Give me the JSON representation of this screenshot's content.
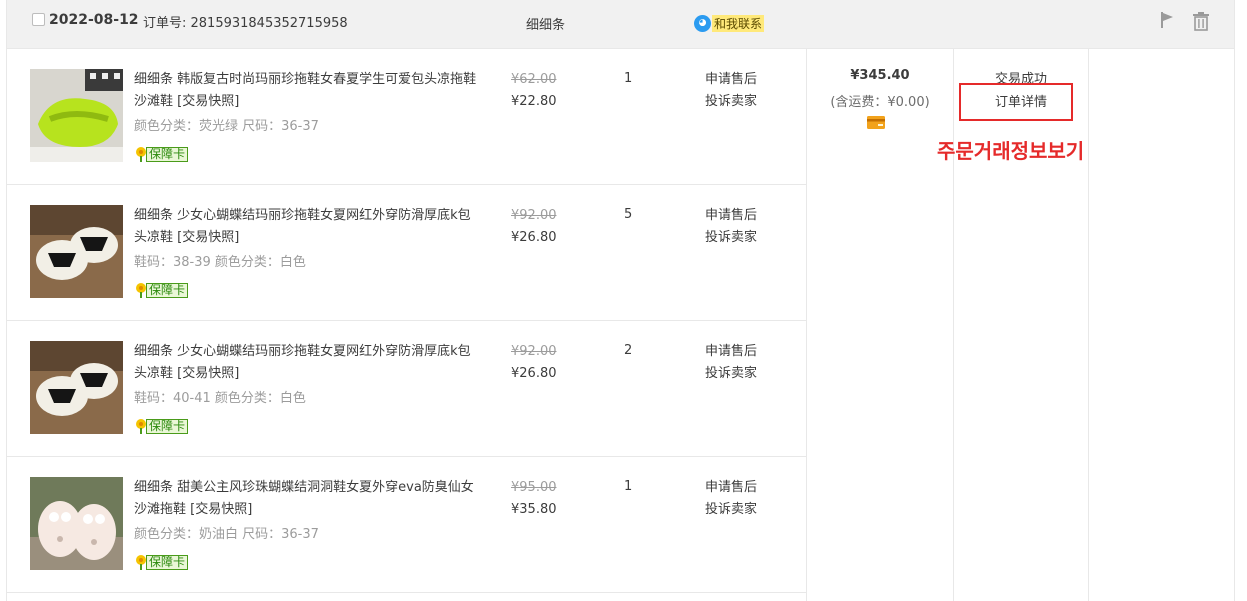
{
  "order": {
    "date": "2022-08-12",
    "order_no_label": "订单号: 2815931845352715958",
    "shop": "细细条",
    "contact": "和我联系"
  },
  "items": [
    {
      "title": "细细条 韩版复古时尚玛丽珍拖鞋女春夏学生可爱包头凉拖鞋沙滩鞋",
      "snapshot": "[交易快照]",
      "sku": "颜色分类：荧光绿  尺码：36-37",
      "guarantee": "保障卡",
      "orig_price": "¥62.00",
      "price": "¥22.80",
      "qty": "1",
      "op1": "申请售后",
      "op2": "投诉卖家"
    },
    {
      "title": "细细条 少女心蝴蝶结玛丽珍拖鞋女夏网红外穿防滑厚底k包头凉鞋",
      "snapshot": "[交易快照]",
      "sku": "鞋码：38-39  颜色分类：白色",
      "guarantee": "保障卡",
      "orig_price": "¥92.00",
      "price": "¥26.80",
      "qty": "5",
      "op1": "申请售后",
      "op2": "投诉卖家"
    },
    {
      "title": "细细条 少女心蝴蝶结玛丽珍拖鞋女夏网红外穿防滑厚底k包头凉鞋",
      "snapshot": "[交易快照]",
      "sku": "鞋码：40-41  颜色分类：白色",
      "guarantee": "保障卡",
      "orig_price": "¥92.00",
      "price": "¥26.80",
      "qty": "2",
      "op1": "申请售后",
      "op2": "投诉卖家"
    },
    {
      "title": "细细条 甜美公主风珍珠蝴蝶结洞洞鞋女夏外穿eva防臭仙女沙滩拖鞋",
      "snapshot": "[交易快照]",
      "sku": "颜色分类：奶油白  尺码：36-37",
      "guarantee": "保障卡",
      "orig_price": "¥95.00",
      "price": "¥35.80",
      "qty": "1",
      "op1": "申请售后",
      "op2": "投诉卖家"
    }
  ],
  "summary": {
    "total": "¥345.40",
    "shipping": "(含运费：¥0.00)",
    "status": "交易成功",
    "detail_link": "订单详情"
  },
  "annotation": "주문거래정보보기",
  "colors": {
    "header_bg": "#f1f1f1",
    "annotation_red": "#e52a2a",
    "guarantee_green": "#2c8a0e",
    "contact_yellow": "#ffe97a"
  }
}
